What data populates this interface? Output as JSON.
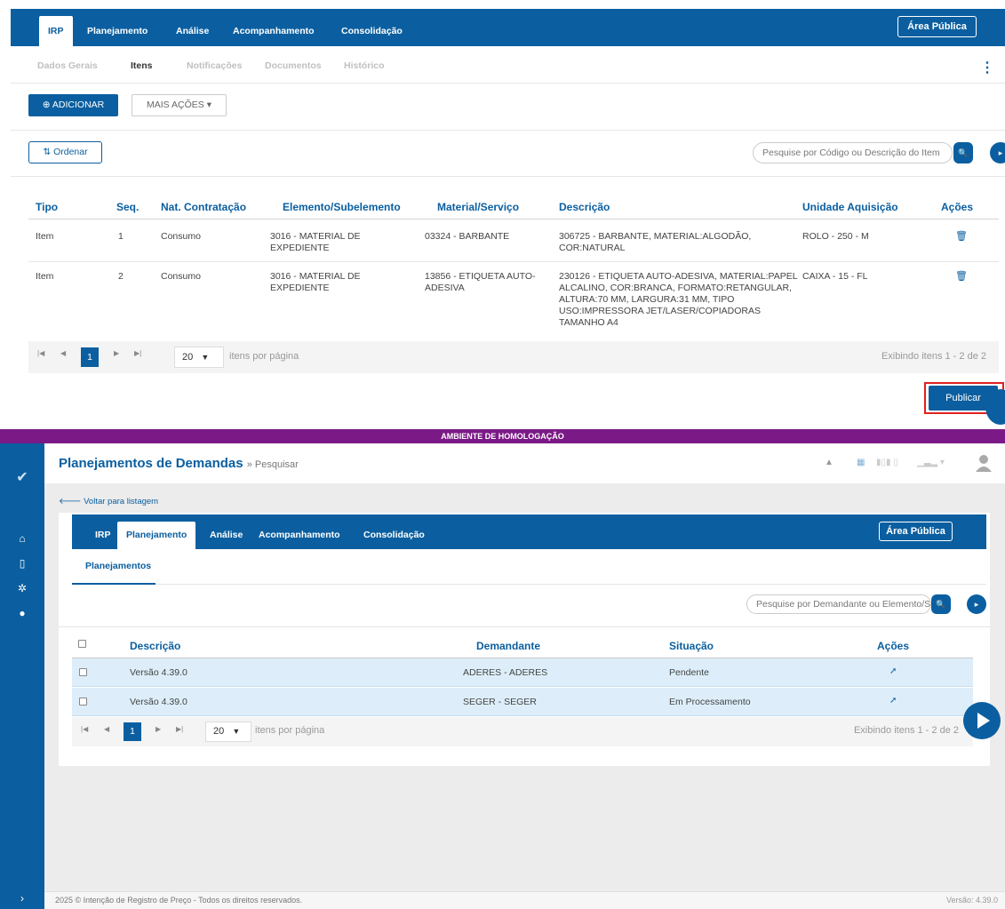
{
  "top": {
    "nav_tabs": [
      "IRP",
      "Planejamento",
      "Análise",
      "Acompanhamento",
      "Consolidação"
    ],
    "area_publica": "Área Pública",
    "sub_tabs": [
      "Dados Gerais",
      "Itens",
      "Notificações",
      "Documentos",
      "Histórico"
    ],
    "add_button": "ADICIONAR",
    "more_actions": "MAIS AÇÕES",
    "order_button": "Ordenar",
    "search_placeholder": "Pesquise por Código ou Descrição do Item",
    "table": {
      "headers": [
        "Tipo",
        "Seq.",
        "Nat. Contratação",
        "Elemento/Subelemento",
        "Material/Serviço",
        "Descrição",
        "Unidade Aquisição",
        "Ações"
      ],
      "rows": [
        {
          "tipo": "Item",
          "seq": "1",
          "nat": "Consumo",
          "elem1": "3016 - MATERIAL DE",
          "elem2": "EXPEDIENTE",
          "mat1": "03324 - BARBANTE",
          "mat2": "",
          "desc": [
            "306725 - BARBANTE, MATERIAL:ALGODÃO,",
            "COR:NATURAL"
          ],
          "unid": "ROLO - 250 - M"
        },
        {
          "tipo": "Item",
          "seq": "2",
          "nat": "Consumo",
          "elem1": "3016 - MATERIAL DE",
          "elem2": "EXPEDIENTE",
          "mat1": "13856 - ETIQUETA AUTO-",
          "mat2": "ADESIVA",
          "desc": [
            "230126 - ETIQUETA AUTO-ADESIVA, MATERIAL:PAPEL",
            "ALCALINO, COR:BRANCA, FORMATO:RETANGULAR,",
            "ALTURA:70 MM, LARGURA:31 MM, TIPO",
            "USO:IMPRESSORA JET/LASER/COPIADORAS",
            "TAMANHO A4"
          ],
          "unid": "CAIXA - 15 - FL"
        }
      ]
    },
    "pager": {
      "current": "1",
      "per_page": "20",
      "per_page_label": "itens por página",
      "info": "Exibindo itens 1 - 2 de 2"
    },
    "publish_button": "Publicar"
  },
  "bottom": {
    "env_banner": "AMBIENTE DE HOMOLOGAÇÃO",
    "title": "Planejamentos de Demandas",
    "title_sub": "» Pesquisar",
    "back_link": "Voltar para listagem",
    "nav_tabs": [
      "IRP",
      "Planejamento",
      "Análise",
      "Acompanhamento",
      "Consolidação"
    ],
    "area_publica": "Área Pública",
    "planejamentos_tab": "Planejamentos",
    "search_placeholder": "Pesquise por Demandante ou Elemento/Sub",
    "table": {
      "headers": [
        "Descrição",
        "Demandante",
        "Situação",
        "Ações"
      ],
      "rows": [
        {
          "descricao": "Versão 4.39.0",
          "demandante": "ADERES - ADERES",
          "situacao": "Pendente"
        },
        {
          "descricao": "Versão 4.39.0",
          "demandante": "SEGER - SEGER",
          "situacao": "Em Processamento"
        }
      ]
    },
    "pager": {
      "current": "1",
      "per_page": "20",
      "per_page_label": "itens por página",
      "info": "Exibindo itens 1 - 2 de 2"
    },
    "footer_left": "2025 © Intenção de Registro de Preço - Todos os direitos reservados.",
    "footer_right": "Versão: 4.39.0"
  },
  "colors": {
    "primary": "#0b5fa0",
    "banner": "#7b1a86",
    "highlight": "#e02020",
    "row_bg": "#ddeefa"
  },
  "icons": [
    "plus-circle-icon",
    "caret-down-icon",
    "sort-icon",
    "search-icon",
    "chevron-right-icon",
    "trash-icon",
    "kebab-icon",
    "first-page-icon",
    "prev-page-icon",
    "next-page-icon",
    "last-page-icon",
    "home-icon",
    "document-icon",
    "gear-icon",
    "lightbulb-icon",
    "arrow-right-icon",
    "play-icon",
    "bell-icon",
    "avatar-icon",
    "check-logo-icon"
  ]
}
